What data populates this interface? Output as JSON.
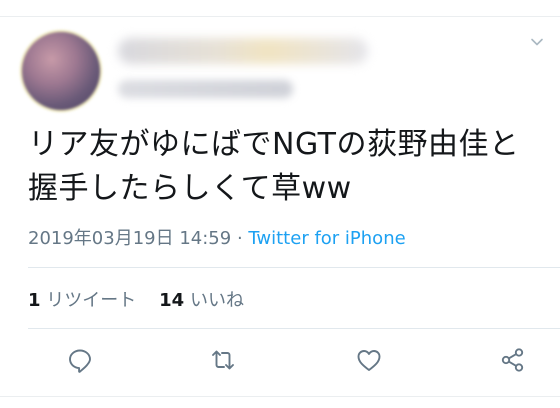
{
  "author": {
    "display_name": "",
    "handle": ""
  },
  "tweet": {
    "text_line1": "リア友がゆにばでNGTの荻野由佳と",
    "text_line2": "握手したらしくて草ww",
    "timestamp": "2019年03月19日 14:59",
    "separator": " · ",
    "source": "Twitter for iPhone"
  },
  "stats": {
    "retweet_count": "1",
    "retweet_label": "リツイート",
    "like_count": "14",
    "like_label": "いいね"
  },
  "actions": [
    {
      "icon": "reply-icon"
    },
    {
      "icon": "retweet-icon"
    },
    {
      "icon": "like-icon"
    },
    {
      "icon": "share-icon"
    }
  ],
  "colors": {
    "link": "#1da1f2",
    "muted": "#657786",
    "text": "#14171a"
  }
}
